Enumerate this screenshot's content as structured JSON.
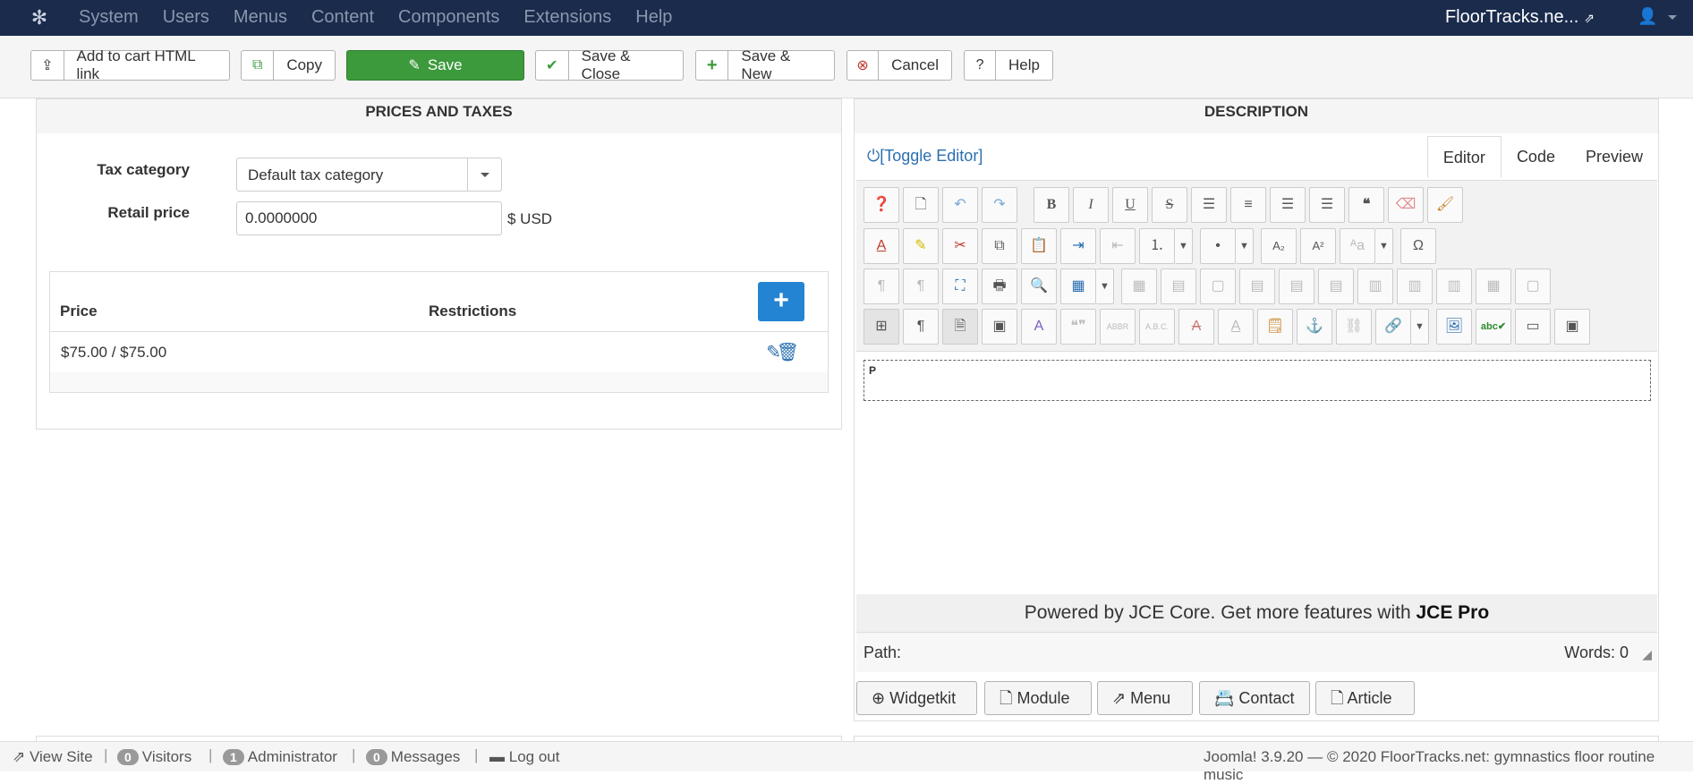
{
  "topnav": {
    "menu": [
      "System",
      "Users",
      "Menus",
      "Content",
      "Components",
      "Extensions",
      "Help"
    ],
    "site_name": "FloorTracks.ne..."
  },
  "toolbar": {
    "add_to_cart": "Add to cart HTML link",
    "copy": "Copy",
    "save": "Save",
    "save_close": "Save & Close",
    "save_new": "Save & New",
    "cancel": "Cancel",
    "help": "Help"
  },
  "prices": {
    "heading": "PRICES AND TAXES",
    "tax_label": "Tax category",
    "tax_value": "Default tax category",
    "retail_label": "Retail price",
    "retail_value": "0.0000000",
    "currency": "$ USD",
    "col_price": "Price",
    "col_restrictions": "Restrictions",
    "add_symbol": "+",
    "rows": [
      {
        "price": "$75.00 / $75.00"
      }
    ]
  },
  "description": {
    "heading": "DESCRIPTION",
    "toggle": "[Toggle Editor]",
    "tabs": [
      "Editor",
      "Code",
      "Preview"
    ],
    "paragraph_tag": "P",
    "powered_text": "Powered by JCE Core. Get more features with",
    "powered_bold": "JCE Pro",
    "path_label": "Path:",
    "words": "Words: 0",
    "buttons": [
      "Widgetkit",
      "Module",
      "Menu",
      "Contact",
      "Article"
    ]
  },
  "footer": {
    "view_site": "View Site",
    "visitors_count": "0",
    "visitors": "Visitors",
    "admin_count": "1",
    "admin": "Administrator",
    "messages_count": "0",
    "messages": "Messages",
    "logout": "Log out",
    "version": "Joomla! 3.9.20",
    "copyright": "— © 2020 FloorTracks.net: gymnastics floor routine music"
  },
  "colors": {
    "topbar": "#1a2b4c",
    "save_green": "#3c9a3c",
    "add_blue": "#2384d3"
  }
}
